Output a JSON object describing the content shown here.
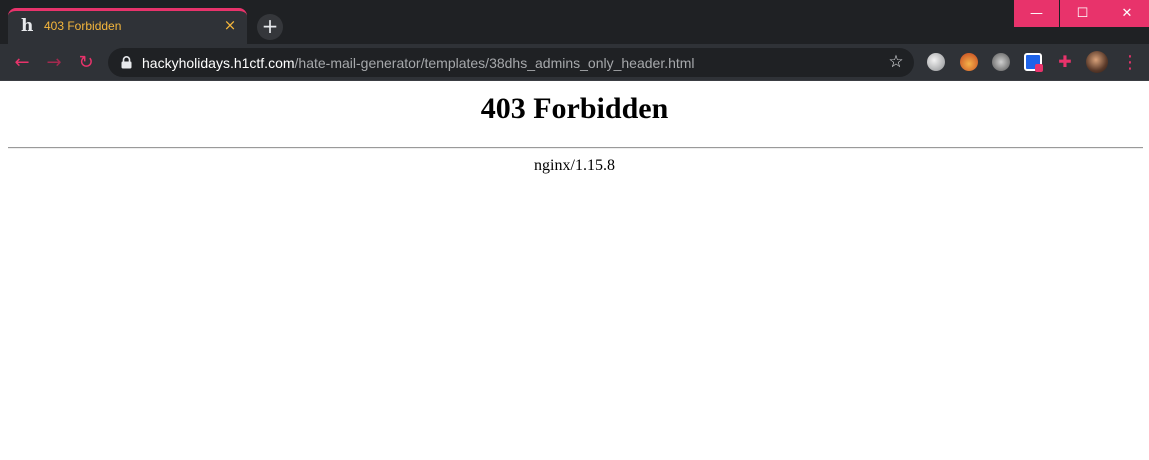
{
  "tab": {
    "favicon": "h",
    "title": "403 Forbidden",
    "close_icon": "×"
  },
  "new_tab_icon": "+",
  "window_controls": {
    "minimize": "—",
    "maximize": "☐",
    "close": "✕"
  },
  "toolbar": {
    "back_icon": "←",
    "forward_icon": "→",
    "reload_icon": "↻",
    "bookmark_icon": "☆",
    "menu_icon": "⋮",
    "extensions_icon": "✚"
  },
  "address": {
    "host": "hackyholidays.h1ctf.com",
    "path": "/hate-mail-generator/templates/38dhs_admins_only_header.html"
  },
  "page": {
    "heading": "403 Forbidden",
    "server": "nginx/1.15.8"
  },
  "colors": {
    "accent": "#e8336b",
    "tab_title": "#f6b73c",
    "frame": "#1f2124",
    "toolbar": "#2f3237"
  }
}
